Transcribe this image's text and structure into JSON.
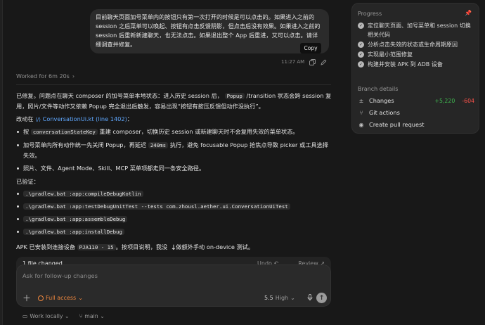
{
  "user_message": {
    "text": "目前聊天页面加号菜单内的按钮只有第一次打开的时候是可以点击的。如果进入之前的 session 之后菜单可以唤起、按钮有点击反馈阴影，但点击后没有效果。如果进入之前的 session 后重新新建聊天，也无法点击。如果退出整个 App 后重进，又可以点击。请详细调查并修复。",
    "copy_tooltip": "Copy",
    "time": "11:27 AM"
  },
  "worked": {
    "label": "Worked for 6m 20s",
    "chevron": "›"
  },
  "response": {
    "p1_a": "已修复。问题点在聊天 composer 的加号菜单本地状态：进入历史 session 后，",
    "p1_code": "Popup",
    "p1_b": "/transition 状态会跨 session 复用，照片/文件等动作又依赖 Popup 完全退出后触发，容易出现“按钮有按压反馈但动作没执行”。",
    "changed_in": "改动在",
    "file_link": "ConversationUi.kt (line 1402)",
    "file_link_suffix": "：",
    "bullets": [
      {
        "a": "按",
        "code": "conversationStateKey",
        "b": "重建 composer，切换历史 session 或新建聊天时不会复用失效的菜单状态。"
      },
      {
        "a": "加号菜单内所有动作统一先关闭 Popup，再延迟",
        "code": "240ms",
        "b": "执行，避免 focusable Popup 抢焦点导致 picker 或工具选择失效。"
      },
      {
        "a": "照片、文件、Agent Mode、Skill、MCP 菜单项都走同一条安全路径。",
        "code": "",
        "b": ""
      }
    ],
    "verified_label": "已验证：",
    "commands": [
      ".\\gradlew.bat :app:compileDebugKotlin",
      ".\\gradlew.bat :app:testDebugUnitTest --tests com.zhousl.aether.ui.ConversationUiTest",
      ".\\gradlew.bat :app:assembleDebug",
      ".\\gradlew.bat :app:installDebug"
    ],
    "apk_a": "APK 已安装到连接设备",
    "apk_code": "PJA110 - 15",
    "apk_b": "。按项目说明，我没",
    "apk_c": "做额外手动 on-device 测试。"
  },
  "composer": {
    "file_changed": "1 file changed",
    "undo": "Undo ↶",
    "review": "Review ↗",
    "placeholder": "Ask for follow-up changes",
    "access_label": "Full access",
    "model": "5.5",
    "effort": "High"
  },
  "footer": {
    "work_mode": "Work locally",
    "branch": "main"
  },
  "panel": {
    "title": "Progress",
    "steps": [
      "定位聊天页面、加号菜单和 session 切换相关代码",
      "分析点击失效的状态或生命周期原因",
      "实现最小范围修复",
      "构建并安装 APK 到 ADB 设备"
    ],
    "branch_title": "Branch details",
    "changes_label": "Changes",
    "additions": "+5,220",
    "deletions": "-604",
    "git_actions": "Git actions",
    "create_pr": "Create pull request"
  },
  "colors": {
    "background": "#181818",
    "link": "#5fa8ff",
    "access": "#f0883e",
    "additions": "#3fb950",
    "deletions": "#f85149"
  }
}
